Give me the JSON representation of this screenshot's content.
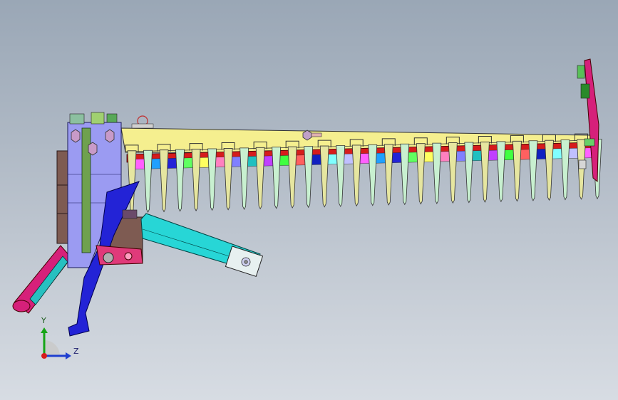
{
  "viewport": {
    "model": "cutter-bar-header-assembly",
    "colors": {
      "beam": "#f5ef8f",
      "frame": "#9b9bf2",
      "redBar": "#d61c1c",
      "cyanArm": "#27d6d6",
      "magenta": "#d6207a",
      "blueLink": "#2323d6",
      "brown": "#7e5b52",
      "finger": "#e6e6a0"
    }
  },
  "triad": {
    "y_label": "Y",
    "z_label": "Z"
  }
}
